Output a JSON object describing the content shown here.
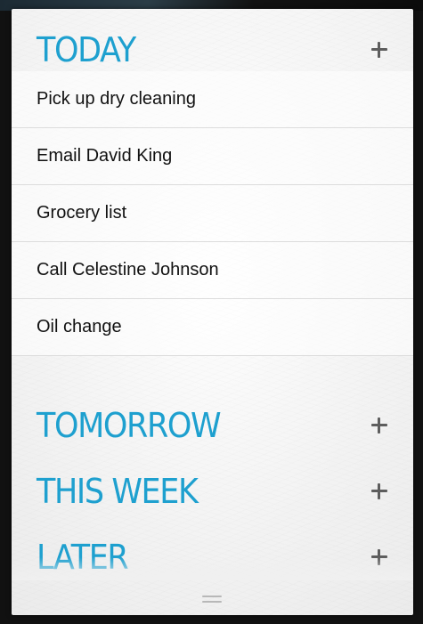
{
  "sections": {
    "today": {
      "title": "TODAY",
      "add_label": "+"
    },
    "tomorrow": {
      "title": "TOMORROW",
      "add_label": "+"
    },
    "this_week": {
      "title": "THIS WEEK",
      "add_label": "+"
    },
    "later": {
      "title": "LATER",
      "add_label": "+"
    }
  },
  "today_tasks": [
    {
      "label": "Pick up dry cleaning"
    },
    {
      "label": "Email David King"
    },
    {
      "label": "Grocery list"
    },
    {
      "label": "Call Celestine Johnson"
    },
    {
      "label": "Oil change"
    }
  ],
  "colors": {
    "accent": "#1ea0cf",
    "icon": "#5d5d5d",
    "text": "#111111"
  },
  "icons": {
    "add": "plus-icon",
    "handle": "drag-handle-icon"
  }
}
